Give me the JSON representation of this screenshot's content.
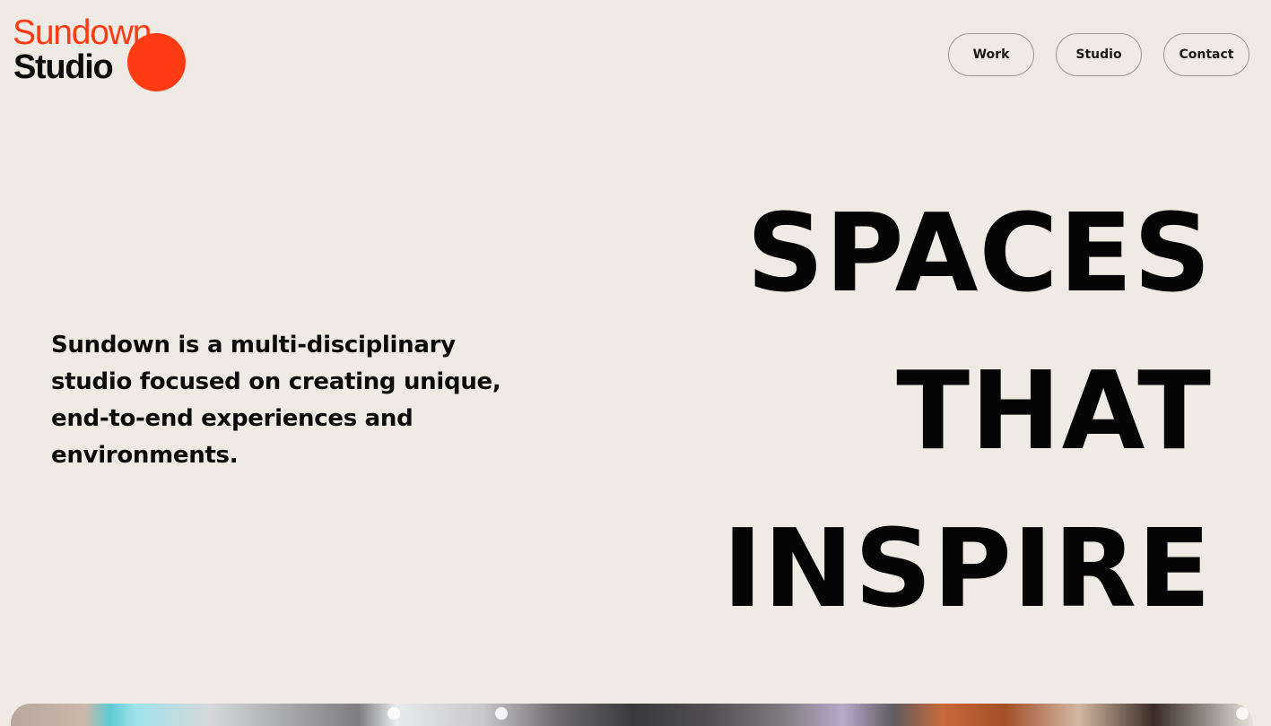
{
  "logo": {
    "line1": "Sundown",
    "line2": "Studio",
    "accent_color": "#ff3b14"
  },
  "nav": {
    "items": [
      {
        "label": "Work"
      },
      {
        "label": "Studio"
      },
      {
        "label": "Contact"
      }
    ]
  },
  "intro": {
    "text": "Sundown is a multi-disciplinary studio focused on creating unique, end-to-end experiences and environments."
  },
  "headline": {
    "lines": [
      "SPACES",
      "THAT",
      "INSPIRE"
    ]
  },
  "colors": {
    "background": "#efeae4",
    "text": "#0b0b0b"
  }
}
